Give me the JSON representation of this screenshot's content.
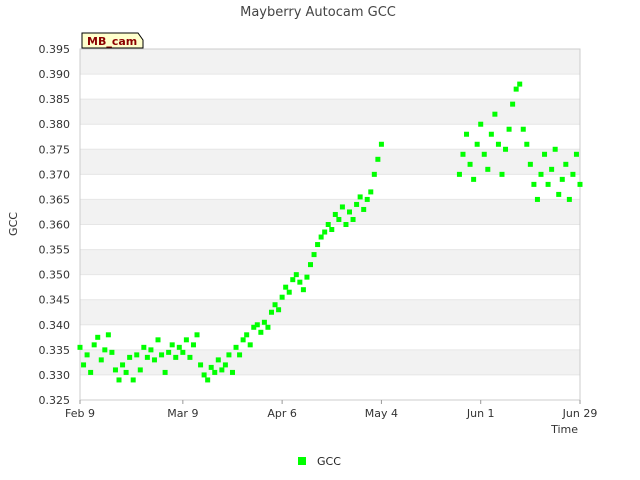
{
  "chart_data": {
    "type": "scatter",
    "title": "Mayberry Autocam GCC",
    "xlabel": "Time",
    "ylabel": "GCC",
    "badge": "MB_cam",
    "xlim": [
      "2024-02-09",
      "2024-06-29"
    ],
    "ylim": [
      0.325,
      0.395
    ],
    "x_ticks": [
      "2024-02-09",
      "2024-03-09",
      "2024-04-06",
      "2024-05-04",
      "2024-06-01",
      "2024-06-29"
    ],
    "x_tick_labels": [
      "Feb 9",
      "Mar 9",
      "Apr 6",
      "May 4",
      "Jun 1",
      "Jun 29"
    ],
    "y_ticks": [
      0.325,
      0.33,
      0.335,
      0.34,
      0.345,
      0.35,
      0.355,
      0.36,
      0.365,
      0.37,
      0.375,
      0.38,
      0.385,
      0.39,
      0.395
    ],
    "y_tick_labels": [
      "0.325",
      "0.330",
      "0.335",
      "0.340",
      "0.345",
      "0.350",
      "0.355",
      "0.360",
      "0.365",
      "0.370",
      "0.375",
      "0.380",
      "0.385",
      "0.390",
      "0.395"
    ],
    "grid": true,
    "legend_position": "bottom-center",
    "marker_color": "#00ff00",
    "series": [
      {
        "name": "GCC",
        "points": [
          [
            "2024-02-09",
            0.3355
          ],
          [
            "2024-02-10",
            0.332
          ],
          [
            "2024-02-11",
            0.334
          ],
          [
            "2024-02-12",
            0.3305
          ],
          [
            "2024-02-13",
            0.336
          ],
          [
            "2024-02-14",
            0.3375
          ],
          [
            "2024-02-15",
            0.333
          ],
          [
            "2024-02-16",
            0.335
          ],
          [
            "2024-02-17",
            0.338
          ],
          [
            "2024-02-18",
            0.3345
          ],
          [
            "2024-02-19",
            0.331
          ],
          [
            "2024-02-20",
            0.329
          ],
          [
            "2024-02-21",
            0.332
          ],
          [
            "2024-02-22",
            0.3305
          ],
          [
            "2024-02-23",
            0.3335
          ],
          [
            "2024-02-24",
            0.329
          ],
          [
            "2024-02-25",
            0.334
          ],
          [
            "2024-02-26",
            0.331
          ],
          [
            "2024-02-27",
            0.3355
          ],
          [
            "2024-02-28",
            0.3335
          ],
          [
            "2024-02-29",
            0.335
          ],
          [
            "2024-03-01",
            0.333
          ],
          [
            "2024-03-02",
            0.337
          ],
          [
            "2024-03-03",
            0.334
          ],
          [
            "2024-03-04",
            0.3305
          ],
          [
            "2024-03-05",
            0.3345
          ],
          [
            "2024-03-06",
            0.336
          ],
          [
            "2024-03-07",
            0.3335
          ],
          [
            "2024-03-08",
            0.3355
          ],
          [
            "2024-03-09",
            0.3345
          ],
          [
            "2024-03-10",
            0.337
          ],
          [
            "2024-03-11",
            0.3335
          ],
          [
            "2024-03-12",
            0.336
          ],
          [
            "2024-03-13",
            0.338
          ],
          [
            "2024-03-14",
            0.332
          ],
          [
            "2024-03-15",
            0.33
          ],
          [
            "2024-03-16",
            0.329
          ],
          [
            "2024-03-17",
            0.3315
          ],
          [
            "2024-03-18",
            0.3305
          ],
          [
            "2024-03-19",
            0.333
          ],
          [
            "2024-03-20",
            0.331
          ],
          [
            "2024-03-21",
            0.332
          ],
          [
            "2024-03-22",
            0.334
          ],
          [
            "2024-03-23",
            0.3305
          ],
          [
            "2024-03-24",
            0.3355
          ],
          [
            "2024-03-25",
            0.334
          ],
          [
            "2024-03-26",
            0.337
          ],
          [
            "2024-03-27",
            0.338
          ],
          [
            "2024-03-28",
            0.336
          ],
          [
            "2024-03-29",
            0.3395
          ],
          [
            "2024-03-30",
            0.34
          ],
          [
            "2024-03-31",
            0.3385
          ],
          [
            "2024-04-01",
            0.3405
          ],
          [
            "2024-04-02",
            0.3395
          ],
          [
            "2024-04-03",
            0.3425
          ],
          [
            "2024-04-04",
            0.344
          ],
          [
            "2024-04-05",
            0.343
          ],
          [
            "2024-04-06",
            0.3455
          ],
          [
            "2024-04-07",
            0.3475
          ],
          [
            "2024-04-08",
            0.3465
          ],
          [
            "2024-04-09",
            0.349
          ],
          [
            "2024-04-10",
            0.35
          ],
          [
            "2024-04-11",
            0.3485
          ],
          [
            "2024-04-12",
            0.347
          ],
          [
            "2024-04-13",
            0.3495
          ],
          [
            "2024-04-14",
            0.352
          ],
          [
            "2024-04-15",
            0.354
          ],
          [
            "2024-04-16",
            0.356
          ],
          [
            "2024-04-17",
            0.3575
          ],
          [
            "2024-04-18",
            0.3585
          ],
          [
            "2024-04-19",
            0.36
          ],
          [
            "2024-04-20",
            0.359
          ],
          [
            "2024-04-21",
            0.362
          ],
          [
            "2024-04-22",
            0.361
          ],
          [
            "2024-04-23",
            0.3635
          ],
          [
            "2024-04-24",
            0.36
          ],
          [
            "2024-04-25",
            0.3625
          ],
          [
            "2024-04-26",
            0.361
          ],
          [
            "2024-04-27",
            0.364
          ],
          [
            "2024-04-28",
            0.3655
          ],
          [
            "2024-04-29",
            0.363
          ],
          [
            "2024-04-30",
            0.365
          ],
          [
            "2024-05-01",
            0.3665
          ],
          [
            "2024-05-02",
            0.37
          ],
          [
            "2024-05-03",
            0.373
          ],
          [
            "2024-05-04",
            0.376
          ],
          [
            "2024-05-26",
            0.37
          ],
          [
            "2024-05-27",
            0.374
          ],
          [
            "2024-05-28",
            0.378
          ],
          [
            "2024-05-29",
            0.372
          ],
          [
            "2024-05-30",
            0.369
          ],
          [
            "2024-05-31",
            0.376
          ],
          [
            "2024-06-01",
            0.38
          ],
          [
            "2024-06-02",
            0.374
          ],
          [
            "2024-06-03",
            0.371
          ],
          [
            "2024-06-04",
            0.378
          ],
          [
            "2024-06-05",
            0.382
          ],
          [
            "2024-06-06",
            0.376
          ],
          [
            "2024-06-07",
            0.37
          ],
          [
            "2024-06-08",
            0.375
          ],
          [
            "2024-06-09",
            0.379
          ],
          [
            "2024-06-10",
            0.384
          ],
          [
            "2024-06-11",
            0.387
          ],
          [
            "2024-06-12",
            0.388
          ],
          [
            "2024-06-13",
            0.379
          ],
          [
            "2024-06-14",
            0.376
          ],
          [
            "2024-06-15",
            0.372
          ],
          [
            "2024-06-16",
            0.368
          ],
          [
            "2024-06-17",
            0.365
          ],
          [
            "2024-06-18",
            0.37
          ],
          [
            "2024-06-19",
            0.374
          ],
          [
            "2024-06-20",
            0.368
          ],
          [
            "2024-06-21",
            0.371
          ],
          [
            "2024-06-22",
            0.375
          ],
          [
            "2024-06-23",
            0.366
          ],
          [
            "2024-06-24",
            0.369
          ],
          [
            "2024-06-25",
            0.372
          ],
          [
            "2024-06-26",
            0.365
          ],
          [
            "2024-06-27",
            0.37
          ],
          [
            "2024-06-28",
            0.374
          ],
          [
            "2024-06-29",
            0.368
          ]
        ]
      }
    ]
  }
}
